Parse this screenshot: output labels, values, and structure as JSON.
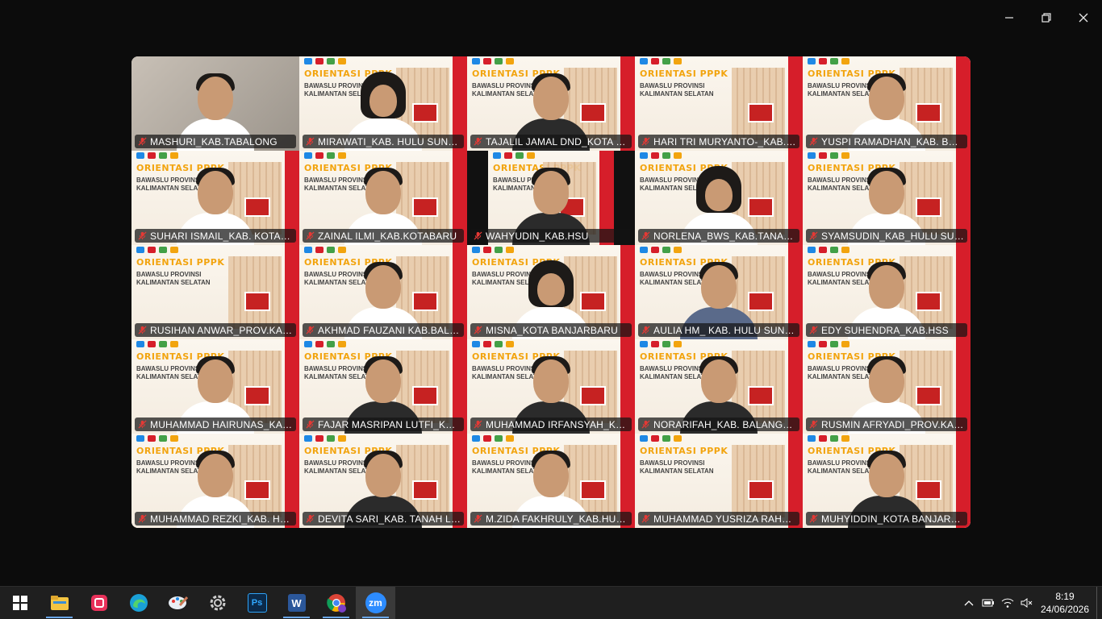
{
  "window": {
    "controls": [
      "minimize",
      "restore",
      "close"
    ]
  },
  "participants": [
    {
      "name": "MASHURI_KAB.TABALONG",
      "cam": "plain"
    },
    {
      "name": "MIRAWATI_KAB. HULU SUNGAI TENGAH",
      "cam": "slide",
      "person": "hijab"
    },
    {
      "name": "TAJALIL JAMAL DND_KOTA BANJARBARU",
      "cam": "slide",
      "person": "dark"
    },
    {
      "name": "HARI TRI MURYANTO-_KAB.BARITO KUALA",
      "cam": "slide"
    },
    {
      "name": "YUSPI RAMADHAN_KAB. BARITO KUALA",
      "cam": "slide",
      "person": "plain"
    },
    {
      "name": "SUHARI ISMAIL_KAB. KOTABARU",
      "cam": "slide",
      "person": "plain"
    },
    {
      "name": "ZAINAL ILMI_KAB.KOTABARU",
      "cam": "slide",
      "person": "plain"
    },
    {
      "name": "WAHYUDIN_KAB.HSU",
      "cam": "dark",
      "person": "dark"
    },
    {
      "name": "NORLENA_BWS_KAB.TANAH BUMBU",
      "cam": "slide",
      "person": "hijab"
    },
    {
      "name": "SYAMSUDIN_KAB_HULU SUNGAI SELATAN",
      "cam": "slide",
      "person": "plain"
    },
    {
      "name": "RUSIHAN ANWAR_PROV.KALIMANTAN SELATAN",
      "cam": "slide"
    },
    {
      "name": "AKHMAD FAUZANI KAB.BALANGAN",
      "cam": "slide",
      "person": "plain"
    },
    {
      "name": "MISNA_KOTA BANJARBARU",
      "cam": "slide",
      "person": "hijab"
    },
    {
      "name": "AULIA HM_ KAB. HULU SUNGAI UTARA",
      "cam": "slide",
      "person": "blue"
    },
    {
      "name": "EDY SUHENDRA_KAB.HSS",
      "cam": "slide",
      "person": "plain"
    },
    {
      "name": "MUHAMMAD HAIRUNAS_KAB.BANJAR",
      "cam": "slide",
      "person": "plain"
    },
    {
      "name": "FAJAR MASRIPAN LUTFI_KAB.TAPIN",
      "cam": "slide",
      "person": "dark"
    },
    {
      "name": "MUHAMMAD IRFANSYAH_KAB.TANAH LAUT",
      "cam": "slide",
      "person": "dark"
    },
    {
      "name": "NORARIFAH_KAB. BALANGAN",
      "cam": "slide",
      "person": "dark"
    },
    {
      "name": "RUSMIN AFRYADI_PROV.KALIMANTAN SELATAN",
      "cam": "slide",
      "person": "plain",
      "active": true
    },
    {
      "name": "MUHAMMAD REZKI_KAB. HULU SUNGAI UTARA",
      "cam": "slide",
      "person": "plain"
    },
    {
      "name": "DEVITA SARI_KAB. TANAH LAUT",
      "cam": "slide",
      "person": "dark"
    },
    {
      "name": "M.ZIDA FAKHRULY_KAB.HULU SUNGAI TENGAH",
      "cam": "slide",
      "person": "plain"
    },
    {
      "name": "MUHAMMAD YUSRIZA RAHMAN_KAB.TAPIN",
      "cam": "slide"
    },
    {
      "name": "MUHYIDDIN_KOTA BANJARBARU",
      "cam": "slide",
      "person": "dark"
    }
  ],
  "slide": {
    "title": "ORIENTASI PPPK",
    "line1": "BAWASLU PROVINSI",
    "line2": "KALIMANTAN SELATAN"
  },
  "colors": {
    "active_border": "#33d17a",
    "slide_title": "#f2a40e",
    "slide_accent": "#d61e2a",
    "muted_icon": "#e53935"
  },
  "taskbar": {
    "apps": [
      {
        "icon": "windows-start-icon"
      },
      {
        "icon": "file-explorer-icon"
      },
      {
        "icon": "snipping-app-icon"
      },
      {
        "icon": "edge-browser-icon"
      },
      {
        "icon": "paint-app-icon"
      },
      {
        "icon": "settings-app-icon"
      },
      {
        "icon": "photoshop-icon",
        "label": "Ps"
      },
      {
        "icon": "word-icon",
        "label": "W"
      },
      {
        "icon": "chrome-icon"
      },
      {
        "icon": "zoom-icon",
        "label": "zm"
      }
    ],
    "clock": {
      "time": "8:19",
      "date": "24/06/2026"
    }
  }
}
